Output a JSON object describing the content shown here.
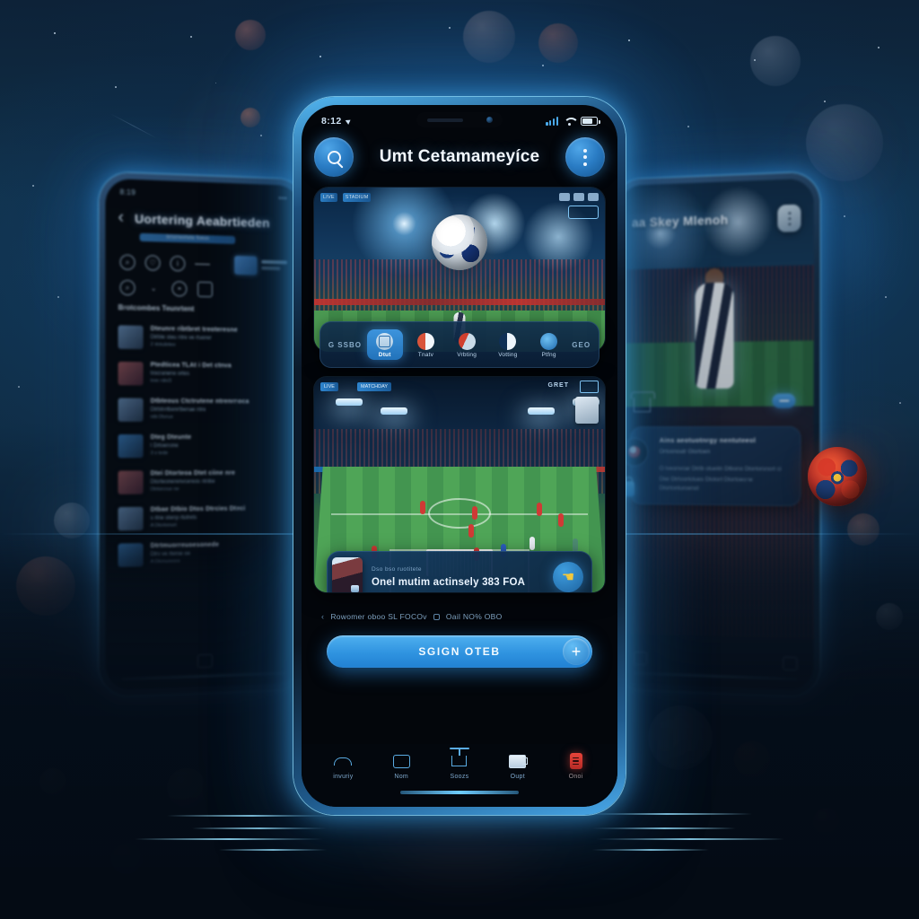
{
  "background": {
    "accent_blue": "#2f93e0",
    "deep_navy": "#0b2036",
    "glow_cyan": "#7fd2fa"
  },
  "center_phone": {
    "status_bar": {
      "time": "8:12",
      "location_icon": "location-arrow-icon",
      "signal_icon": "cellular-signal-icon",
      "wifi_icon": "wifi-icon",
      "battery_icon": "battery-icon"
    },
    "header": {
      "search_icon": "search-icon",
      "title": "Umt Cetamameyíce",
      "menu_icon": "kebab-menu-icon"
    },
    "hero_card": {
      "badges_left": [
        "LIVE",
        "STADIUM"
      ],
      "score_box_label": "",
      "ball_icon": "soccer-ball-icon"
    },
    "filter_strip": {
      "left_label": "G SSBO",
      "right_label": "GEO",
      "items": [
        {
          "label": "Dtut",
          "icon": "field-filter-icon",
          "active": true
        },
        {
          "label": "Tnatv",
          "icon": "half-red-circle-icon",
          "active": false
        },
        {
          "label": "Vrbting",
          "icon": "red-swirl-circle-icon",
          "active": false
        },
        {
          "label": "Votting",
          "icon": "half-dark-circle-icon",
          "active": false
        },
        {
          "label": "Ptfng",
          "icon": "blue-wave-circle-icon",
          "active": false
        }
      ]
    },
    "match_card": {
      "chip_left": "LIVE",
      "chip_left2": "MATCHDAY",
      "tag_right": "GRET",
      "preview_box": "mini-preview-icon"
    },
    "promo": {
      "subtitle": "Dso bso ruotitete",
      "title": "Onel mutim actinsely 383 FOA",
      "action_icon": "bookmark-hand-icon",
      "thumb_icon": "match-poster-thumbnail"
    },
    "promo_meta": {
      "caret": "‹",
      "text_left": "Rowomer oboo SL FOCOv",
      "text_right": "Oail NO% OBO"
    },
    "cta": {
      "label": "SGIGN OTEB",
      "plus_icon": "plus-icon"
    },
    "bottom_nav": [
      {
        "label": "invuriy",
        "icon": "home-icon",
        "active": false
      },
      {
        "label": "Nom",
        "icon": "card-icon",
        "active": false
      },
      {
        "label": "Soozs",
        "icon": "goal-post-icon",
        "active": false
      },
      {
        "label": "Oupt",
        "icon": "news-icon",
        "active": false
      },
      {
        "label": "Onoi",
        "icon": "alert-badge-icon",
        "active": true
      }
    ]
  },
  "left_phone": {
    "status_time": "8:19",
    "back_icon": "chevron-left-icon",
    "title": "Uortering Aeabrtieden",
    "subtitle_pill": "brtomeirtete foeus",
    "icon_row_1": [
      "search-icon",
      "heart-icon",
      "info-icon",
      "list-icon"
    ],
    "icon_row_2": [
      "search-icon",
      "chevron-down-icon",
      "drop-icon",
      "card-icon"
    ],
    "mini_card": {
      "title": "Dtuveamd",
      "subtitle": "rtnre rtoese"
    },
    "section_header": "Brotcombes Teunrtent",
    "list_items": [
      {
        "title": "Dteunre ribtbret treoteresne",
        "subtitle": "Dtrbte steu ntre ve rtuorer",
        "meta": "2 rtntubrtee"
      },
      {
        "title": "Ptedticea TLAt i Det ctnva",
        "subtitle": "trocranene ortes",
        "meta": "tnre rdn/3"
      },
      {
        "title": "Dtbteous Ctctrutene  ntrenrnoca",
        "subtitle": "Dtrbtnrtbenrtbenae ntre",
        "meta": "ntb Dtvrue"
      },
      {
        "title": "Dteg Dteunte",
        "subtitle": "t Drtoenone",
        "meta": "3 s tede"
      },
      {
        "title": "Dtei Dtorteoa Dtet ciine nre",
        "subtitle": "Dtorteonerenvcereos ntnbe",
        "meta": "Dtrtorcrue ne"
      },
      {
        "title": "Dtbae Dtbio Dtos Dtrcies Dteci",
        "subtitle": "s rtne otenp rtutrets",
        "meta": "A Dtortonurt"
      },
      {
        "title": "Dtrtmuorreuoesonede",
        "subtitle": "Dtrv ve rteroe oe",
        "meta": "A Dtonuovore"
      }
    ],
    "nav_icon": "card-icon"
  },
  "right_phone": {
    "title": "aa Skey Mlenoh",
    "menu_icon": "kebab-menu-icon",
    "chip_icon": "pill-chip-icon",
    "goal_icon": "goal-post-icon",
    "notification": {
      "avatar": "player-avatar",
      "title": "Ains aeotuotnrgy nentuteeol",
      "subtitle": "Ortoonoutr  Gtortoen",
      "body_line_1": "O tveonvoar Dtrtb otueitn Dtbono Dtortorsnort ci",
      "body_line_2": "Dtei Dtrtoortotues Dtotort Dtortoeone Dtortonturoenot"
    },
    "lock_icon": "lock-icon",
    "nav_icon": "card-icon"
  },
  "decor": {
    "floating_ball": "colorful-soccer-ball-decor",
    "bokeh_spheres": "bokeh-sphere-decor",
    "light_streaks": "light-streak-decor"
  }
}
